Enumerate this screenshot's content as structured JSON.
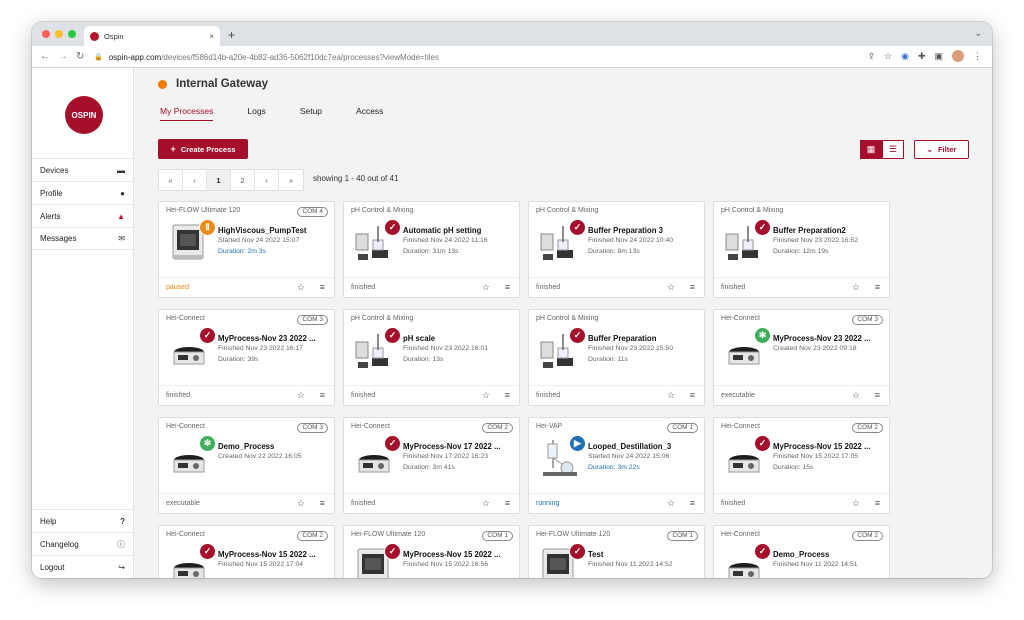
{
  "browser": {
    "tab_title": "Ospin",
    "tab_close": "×",
    "new_tab": "+",
    "url_host": "ospin-app.com",
    "url_path": "/devices/f586d14b-a20e-4b82-ad36-5062f10dc7ea/processes?viewMode=tiles"
  },
  "sidebar": {
    "logo": "OSPIN",
    "items": [
      {
        "label": "Devices",
        "icon": "device-icon"
      },
      {
        "label": "Profile",
        "icon": "user-icon"
      },
      {
        "label": "Alerts",
        "icon": "bell-icon"
      },
      {
        "label": "Messages",
        "icon": "envelope-icon"
      }
    ],
    "bottom": [
      {
        "label": "Help",
        "icon": "question-icon"
      },
      {
        "label": "Changelog",
        "icon": "info-icon"
      },
      {
        "label": "Logout",
        "icon": "logout-icon"
      }
    ]
  },
  "header": {
    "gateway_name": "Internal Gateway",
    "tabs": [
      "My Processes",
      "Logs",
      "Setup",
      "Access"
    ]
  },
  "toolbar": {
    "create_label": "Create Process",
    "filter_label": "Filter"
  },
  "pagination": {
    "pages": [
      "«",
      "‹",
      "1",
      "2",
      "›",
      "»"
    ],
    "showing": "showing 1 - 40 out of 41"
  },
  "colors": {
    "brand": "#a50f2b",
    "finished": "#a50f2b",
    "paused": "#ee8c1a",
    "executable": "#3fae5b",
    "running": "#1f6fb5"
  },
  "cards": [
    {
      "device": "Hei-FLOW Ultimate 120",
      "com": "COM 4",
      "name": "HighViscous_PumpTest",
      "date": "Started Nov 24 2022 15:07",
      "duration": "Duration: 2m 3s",
      "state": "paused",
      "kind": "pump"
    },
    {
      "device": "pH Control & Mixing",
      "com": "",
      "name": "Automatic pH setting",
      "date": "Finished Nov 24 2022 11:16",
      "duration": "Duration: 31m 13s",
      "state": "finished",
      "kind": "ph"
    },
    {
      "device": "pH Control & Mixing",
      "com": "",
      "name": "Buffer Preparation 3",
      "date": "Finished Nov 24 2022 10:40",
      "duration": "Duration: 8m 13s",
      "state": "finished",
      "kind": "ph"
    },
    {
      "device": "pH Control & Mixing",
      "com": "",
      "name": "Buffer Preparation2",
      "date": "Finished Nov 23 2022 16:52",
      "duration": "Duration: 12m 19s",
      "state": "finished",
      "kind": "ph"
    },
    {
      "device": "Hei-Connect",
      "com": "COM 3",
      "name": "MyProcess-Nov 23 2022 ...",
      "date": "Finished Nov 23 2022 16:17",
      "duration": "Duration: 39s",
      "state": "finished",
      "kind": "stirrer"
    },
    {
      "device": "pH Control & Mixing",
      "com": "",
      "name": "pH scale",
      "date": "Finished Nov 23 2022 16:01",
      "duration": "Duration: 13s",
      "state": "finished",
      "kind": "ph"
    },
    {
      "device": "pH Control & Mixing",
      "com": "",
      "name": "Buffer Preparation",
      "date": "Finished Nov 23 2022 15:50",
      "duration": "Duration: 11s",
      "state": "finished",
      "kind": "ph"
    },
    {
      "device": "Hei-Connect",
      "com": "COM 3",
      "name": "MyProcess-Nov 23 2022 ...",
      "date": "Created Nov 23 2022 09:18",
      "duration": "",
      "state": "executable",
      "kind": "stirrer"
    },
    {
      "device": "Hei-Connect",
      "com": "COM 3",
      "name": "Demo_Process",
      "date": "Created Nov 22 2022 16:05",
      "duration": "",
      "state": "executable",
      "kind": "stirrer"
    },
    {
      "device": "Hei-Connect",
      "com": "COM 2",
      "name": "MyProcess-Nov 17 2022 ...",
      "date": "Finished Nov 17 2022 16:23",
      "duration": "Duration: 3m 41s",
      "state": "finished",
      "kind": "stirrer"
    },
    {
      "device": "Hei-VAP",
      "com": "COM 1",
      "name": "Looped_Destillation_3",
      "date": "Started Nov 24 2022 15:06",
      "duration": "Duration: 3m 22s",
      "state": "running",
      "kind": "vap"
    },
    {
      "device": "Hei-Connect",
      "com": "COM 2",
      "name": "MyProcess-Nov 15 2022 ...",
      "date": "Finished Nov 15 2022 17:05",
      "duration": "Duration: 15s",
      "state": "finished",
      "kind": "stirrer"
    },
    {
      "device": "Hei-Connect",
      "com": "COM 2",
      "name": "MyProcess-Nov 15 2022 ...",
      "date": "Finished Nov 15 2022 17:04",
      "duration": "",
      "state": "finished",
      "kind": "stirrer"
    },
    {
      "device": "Hei-FLOW Ultimate 120",
      "com": "COM 1",
      "name": "MyProcess-Nov 15 2022 ...",
      "date": "Finished Nov 15 2022 16:56",
      "duration": "",
      "state": "finished",
      "kind": "pump"
    },
    {
      "device": "Hei-FLOW Ultimate 120",
      "com": "COM 1",
      "name": "Test",
      "date": "Finished Nov 11 2022 14:52",
      "duration": "",
      "state": "finished",
      "kind": "pump"
    },
    {
      "device": "Hei-Connect",
      "com": "COM 2",
      "name": "Demo_Process",
      "date": "Finished Nov 11 2022 14:51",
      "duration": "",
      "state": "finished",
      "kind": "stirrer"
    }
  ]
}
